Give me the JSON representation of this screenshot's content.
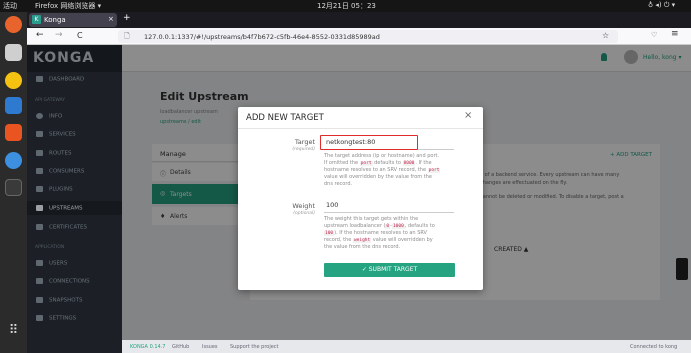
{
  "os": {
    "activities": "活动",
    "app_menu": "Firefox 网络浏览器 ▾",
    "clock": "12月21日 05：23",
    "tray": "♁ ◂) ⏻ ▾"
  },
  "browser": {
    "tab_title": "Konga",
    "tab_close": "×",
    "new_tab": "+",
    "url": "127.0.0.1:1337/#!/upstreams/b4f7b672-c5fb-46e4-8552-0331d85989ad",
    "back": "←",
    "forward": "→",
    "reload": "C",
    "star": "☆",
    "menu": "≡"
  },
  "app": {
    "logo": "KONGA",
    "user": "Hello, kong ▾",
    "nav": {
      "dashboard": "DASHBOARD",
      "api_gateway": "API GATEWAY",
      "info": "INFO",
      "services": "SERVICES",
      "routes": "ROUTES",
      "consumers": "CONSUMERS",
      "plugins": "PLUGINS",
      "upstreams": "UPSTREAMS",
      "certificates": "CERTIFICATES",
      "application": "APPLICATION",
      "users": "USERS",
      "connections": "CONNECTIONS",
      "snapshots": "SNAPSHOTS",
      "settings": "SETTINGS"
    },
    "page_title": "Edit Upstream",
    "page_sub": "loadbalancer upstream",
    "breadcrumb": "upstreams / edit",
    "manage": "Manage",
    "tabs": {
      "details": "Details",
      "targets": "Targets",
      "alerts": "Alerts"
    },
    "add_target_link": "+ ADD TARGET",
    "desc1": "e of a backend service. Every upstream can have many",
    "desc2": "changes are effectuated on the fly.",
    "desc3": "cannot be deleted or modified. To disable a target, post a",
    "created_col": "CREATED ▲",
    "footer": {
      "version": "KONGA 0.14.7",
      "github": "GitHub",
      "issues": "Issues",
      "support": "Support the project",
      "connected": "Connected to kong"
    }
  },
  "modal": {
    "title": "ADD NEW TARGET",
    "close": "×",
    "target_label": "Target",
    "target_required": "(required)",
    "target_value": "netkongtest:80",
    "target_help": [
      "The target address (ip or hostname) and port.",
      "If omitted the ",
      "port",
      " defaults to ",
      "8000",
      ". If the",
      "hostname resolves to an SRV record, the ",
      "port",
      "value will overridden by the value from the",
      "dns record."
    ],
    "weight_label": "Weight",
    "weight_optional": "(optional)",
    "weight_value": "100",
    "weight_help": [
      "The weight this target gets within the",
      "upstream loadbalancer (",
      "0",
      "-",
      "1000",
      ", defaults to",
      "100",
      "). If the hostname resolves to an SRV",
      "record, the ",
      "weight",
      " value will overridden by",
      "the value from the dns record."
    ],
    "submit": "✓  SUBMIT TARGET"
  }
}
